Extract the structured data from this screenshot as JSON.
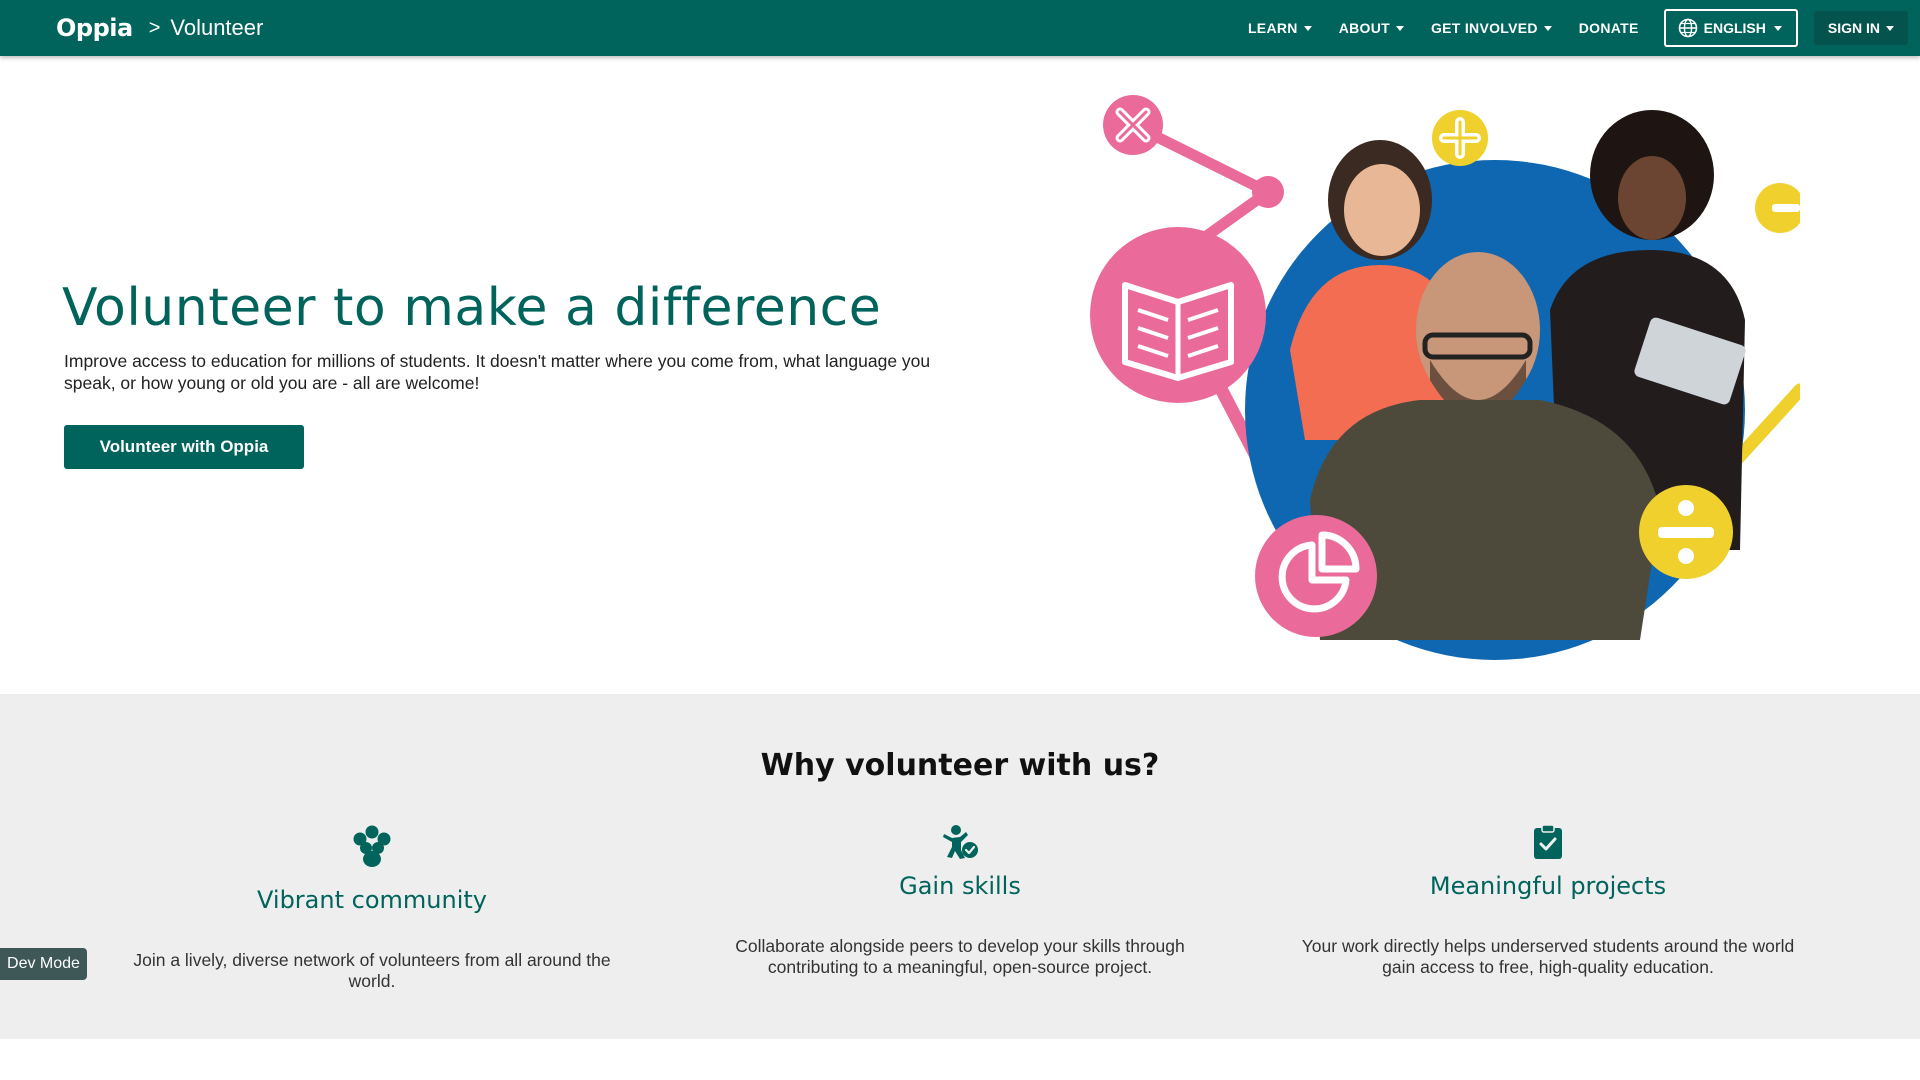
{
  "header": {
    "logo_text": "Oppia",
    "breadcrumb_separator": ">",
    "page_name": "Volunteer",
    "nav": {
      "learn": "LEARN",
      "about": "ABOUT",
      "get_involved": "GET INVOLVED",
      "donate": "DONATE",
      "language": "ENGLISH",
      "sign_in": "SIGN IN"
    }
  },
  "hero": {
    "title": "Volunteer to make a difference",
    "description": "Improve access to education for millions of students. It doesn't matter where you come from, what language you speak, or how young or old you are - all are welcome!",
    "cta_label": "Volunteer with Oppia"
  },
  "why": {
    "title": "Why volunteer with us?",
    "features": [
      {
        "icon": "community-icon",
        "title": "Vibrant community",
        "text": "Join a lively, diverse network of volunteers from all around the world."
      },
      {
        "icon": "skill-check-icon",
        "title": "Gain skills",
        "text": "Collaborate alongside peers to develop your skills through contributing to a meaningful, open-source project."
      },
      {
        "icon": "clipboard-check-icon",
        "title": "Meaningful projects",
        "text": "Your work directly helps underserved students around the world gain access to free, high-quality education."
      }
    ]
  },
  "dev_mode_label": "Dev Mode",
  "colors": {
    "brand": "#00645c",
    "pink": "#ea6b99",
    "yellow": "#f0d02c",
    "blue": "#0e67b0",
    "section_bg": "#eeeeee"
  }
}
